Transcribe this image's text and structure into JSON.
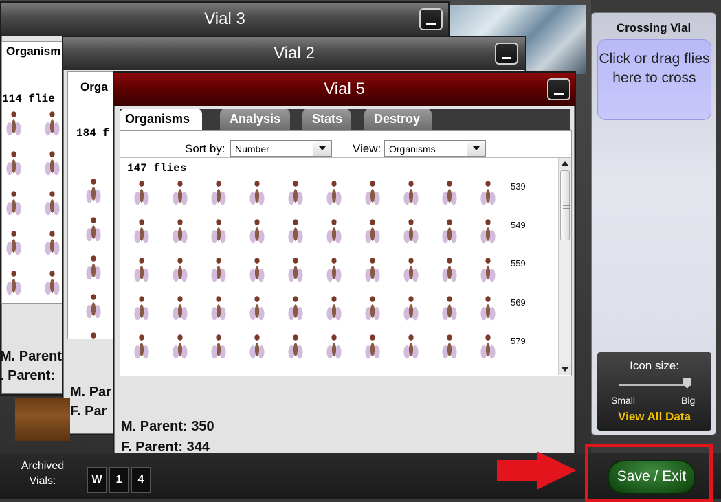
{
  "windows": {
    "vial3": {
      "title": "Vial 3",
      "tab_label": "Organism",
      "count": "114 flie",
      "m_parent": "M. Parent",
      "f_parent": ". Parent:"
    },
    "vial2": {
      "title": "Vial 2",
      "tab_label": "Orga",
      "count": "184 f",
      "m_parent": "M. Par",
      "f_parent": "F. Par"
    },
    "vial5": {
      "title": "Vial 5",
      "tabs": [
        "Organisms",
        "Analysis",
        "Stats",
        "Destroy"
      ],
      "active_tab": "Organisms",
      "sort_label": "Sort by:",
      "sort_value": "Number",
      "view_label": "View:",
      "view_value": "Organisms",
      "count": "147 flies",
      "row_numbers": [
        "539",
        "549",
        "559",
        "569",
        "579"
      ],
      "m_parent": "M. Parent: 350",
      "f_parent": "F. Parent: 344"
    }
  },
  "right_panel": {
    "title": "Crossing Vial",
    "drop_text": "Click or drag flies here to cross",
    "icon_size_label": "Icon size:",
    "small_label": "Small",
    "big_label": "Big",
    "icon_size_level": 0.95,
    "view_all_data": "View All Data"
  },
  "bottom": {
    "archived_label": "Archived Vials:",
    "archived_vials": [
      "W",
      "1",
      "4"
    ],
    "save_exit": "Save / Exit"
  },
  "colors": {
    "vial5_title": "#5e0000",
    "view_all_data": "#f5c400",
    "save_button": "#1b5a1b",
    "highlight": "#e3141c"
  }
}
